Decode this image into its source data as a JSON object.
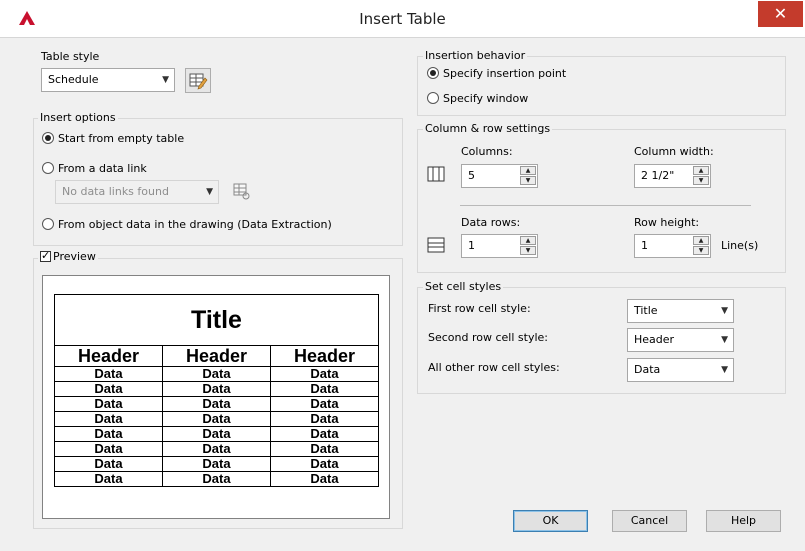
{
  "window": {
    "title": "Insert Table",
    "close_glyph": "✕"
  },
  "table_style": {
    "legend": "Table style",
    "selected": "Schedule"
  },
  "insert_options": {
    "legend": "Insert options",
    "start_empty": "Start from empty table",
    "from_data_link": "From a data link",
    "data_link_select": "No data links found",
    "from_object_data": "From object data in the drawing (Data Extraction)"
  },
  "preview": {
    "label": "Preview",
    "checked": true,
    "title": "Title",
    "headers": [
      "Header",
      "Header",
      "Header"
    ],
    "data_cell": "Data"
  },
  "insertion_behavior": {
    "legend": "Insertion behavior",
    "specify_point": "Specify insertion point",
    "specify_window": "Specify window"
  },
  "column_row": {
    "legend": "Column & row settings",
    "columns_label": "Columns:",
    "columns_value": "5",
    "column_width_label": "Column width:",
    "column_width_value": "2 1/2\"",
    "data_rows_label": "Data rows:",
    "data_rows_value": "1",
    "row_height_label": "Row height:",
    "row_height_value": "1",
    "row_height_unit": "Line(s)"
  },
  "cell_styles": {
    "legend": "Set cell styles",
    "first_label": "First row cell style:",
    "first_value": "Title",
    "second_label": "Second row cell style:",
    "second_value": "Header",
    "other_label": "All other row cell styles:",
    "other_value": "Data"
  },
  "buttons": {
    "ok": "OK",
    "cancel": "Cancel",
    "help": "Help"
  }
}
